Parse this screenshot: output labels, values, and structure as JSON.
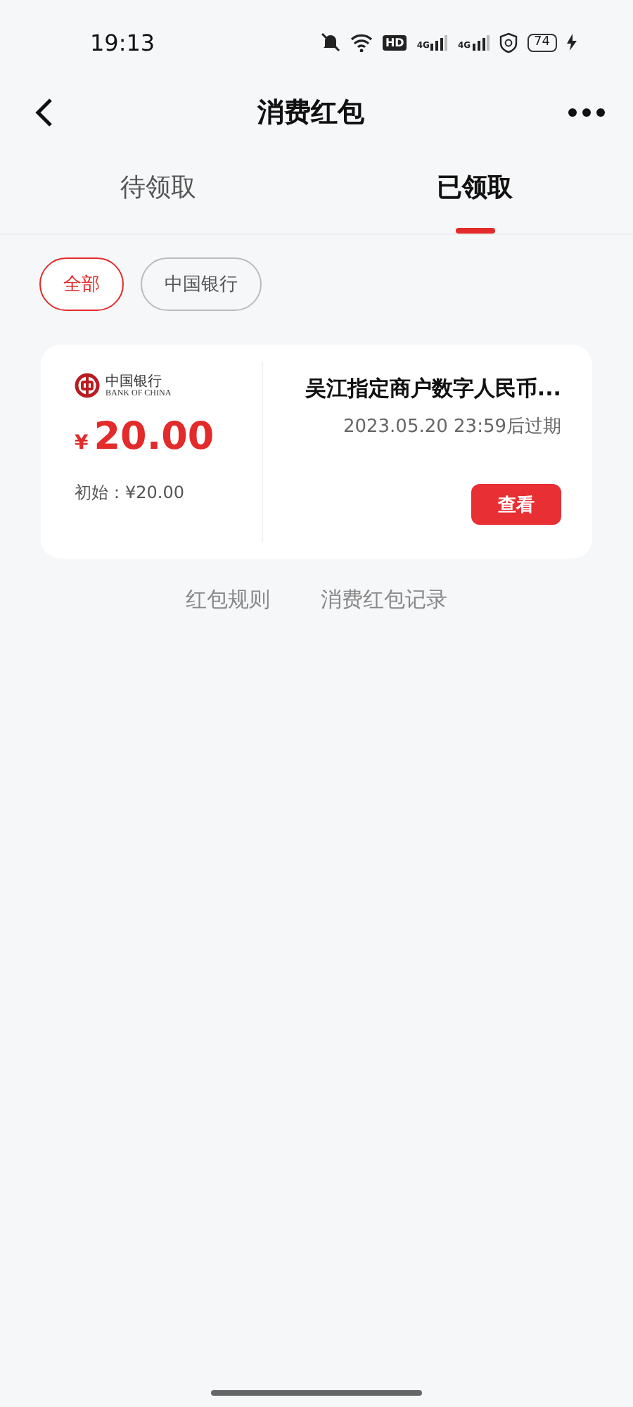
{
  "status_bar": {
    "time": "19:13",
    "hd_label": "HD",
    "network_labels": [
      "4G",
      "4G"
    ],
    "battery": "74"
  },
  "header": {
    "title": "消费红包"
  },
  "tabs": [
    {
      "label": "待领取",
      "selected": false
    },
    {
      "label": "已领取",
      "selected": true
    }
  ],
  "filters": [
    {
      "label": "全部",
      "selected": true
    },
    {
      "label": "中国银行",
      "selected": false
    }
  ],
  "coupons": [
    {
      "bank_name": "中国银行",
      "bank_name_en": "BANK OF CHINA",
      "currency": "¥",
      "amount": "20.00",
      "initial": "初始：¥20.00",
      "title": "吴江指定商户数字人民币...",
      "expiry": "2023.05.20 23:59后过期",
      "action": "查看"
    }
  ],
  "footer_links": [
    "红包规则",
    "消费红包记录"
  ]
}
